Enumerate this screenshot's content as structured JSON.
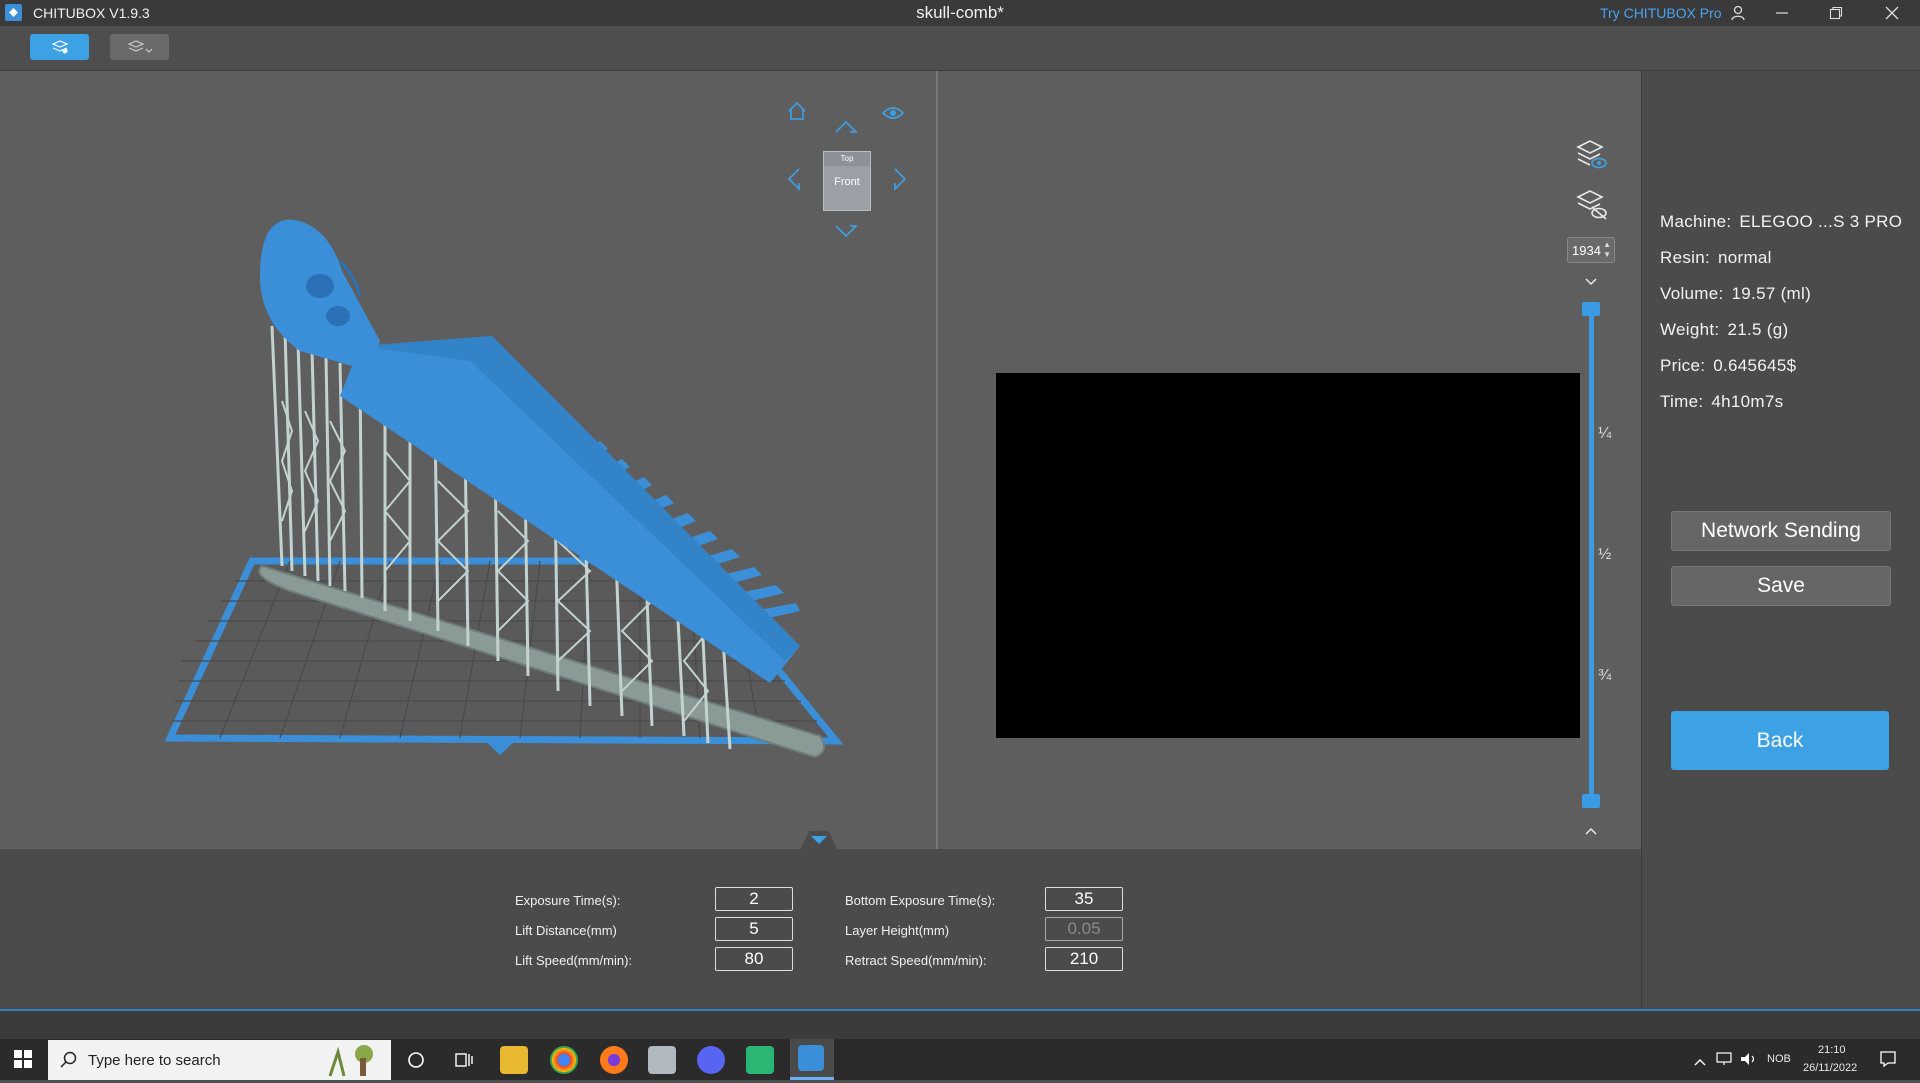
{
  "titlebar": {
    "app_name": "CHITUBOX V1.9.3",
    "document": "skull-comb*",
    "promo_link": "Try CHITUBOX Pro"
  },
  "view_cube": {
    "top_face": "Top",
    "front_face": "Front"
  },
  "layer_preview": {
    "current_layer": "1934",
    "marks": [
      "¼",
      "½",
      "¾"
    ]
  },
  "print_info": {
    "machine_label": "Machine:",
    "machine_value": "ELEGOO ...S 3 PRO",
    "resin_label": "Resin:",
    "resin_value": "normal",
    "volume_label": "Volume:",
    "volume_value": "19.57  (ml)",
    "weight_label": "Weight:",
    "weight_value": "21.5  (g)",
    "price_label": "Price:",
    "price_value": "0.645645$",
    "time_label": "Time:",
    "time_value": "4h10m7s"
  },
  "actions": {
    "network_sending": "Network Sending",
    "save": "Save",
    "back": "Back"
  },
  "parameters": {
    "exposure_time_label": "Exposure Time(s):",
    "exposure_time_value": "2",
    "lift_distance_label": "Lift Distance(mm)",
    "lift_distance_value": "5",
    "lift_speed_label": "Lift Speed(mm/min):",
    "lift_speed_value": "80",
    "bottom_exposure_label": "Bottom Exposure Time(s):",
    "bottom_exposure_value": "35",
    "layer_height_label": "Layer Height(mm)",
    "layer_height_value": "0.05",
    "retract_speed_label": "Retract Speed(mm/min):",
    "retract_speed_value": "210"
  },
  "taskbar": {
    "search_placeholder": "Type here to search",
    "language": "NOB",
    "time": "21:10",
    "date": "26/11/2022"
  },
  "colors": {
    "accent": "#3da1e6",
    "model": "#3b8fd8",
    "supports": "#b8c8c4",
    "plate_border": "#3b8fd8"
  }
}
